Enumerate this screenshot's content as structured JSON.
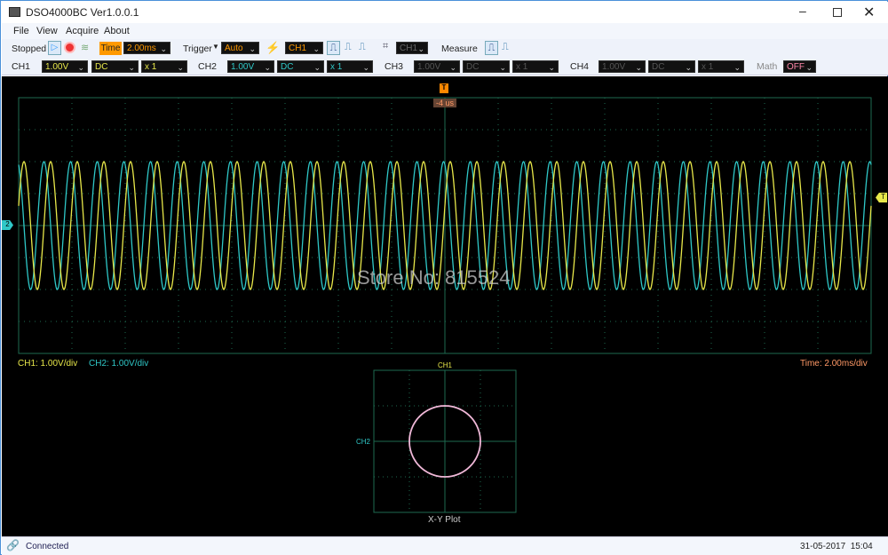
{
  "window": {
    "title": "DSO4000BC Ver1.0.0.1",
    "minimize_icon": "minimize-icon",
    "maximize_icon": "maximize-icon",
    "close_icon": "close-icon"
  },
  "menu": [
    "File",
    "View",
    "Acquire",
    "About"
  ],
  "toolbar": {
    "status": "Stopped",
    "time_label": "Time",
    "timebase": "2.00ms",
    "trigger_label": "Trigger",
    "trigger_mode": "Auto",
    "trigger_source": "CH1",
    "cursor_source": "CH1",
    "measure_label": "Measure"
  },
  "channels": [
    {
      "name": "CH1",
      "volts": "1.00V",
      "coupling": "DC",
      "probe": "x 1",
      "color": "#e8e84a",
      "enabled": true
    },
    {
      "name": "CH2",
      "volts": "1.00V",
      "coupling": "DC",
      "probe": "x 1",
      "color": "#2fc8c8",
      "enabled": true
    },
    {
      "name": "CH3",
      "volts": "1.00V",
      "coupling": "DC",
      "probe": "x 1",
      "enabled": false
    },
    {
      "name": "CH4",
      "volts": "1.00V",
      "coupling": "DC",
      "probe": "x 1",
      "enabled": false
    }
  ],
  "math": {
    "label": "Math",
    "value": "OFF"
  },
  "scope": {
    "trigger_time": "-4 us",
    "trigger_marker": "T",
    "ch2_marker": "2",
    "trigger_level_marker": "T",
    "ch1_scale": "CH1: 1.00V/div",
    "ch2_scale": "CH2: 1.00V/div",
    "time_scale": "Time: 2.00ms/div",
    "watermark": "Store No: 815524",
    "xy_top_label": "CH1",
    "xy_left_label": "CH2",
    "xy_title": "X-Y Plot"
  },
  "chart_data": {
    "type": "line",
    "time_per_div_ms": 2,
    "volts_per_div": 1,
    "x_divisions": 16,
    "y_divisions": 8,
    "xlim_ms": [
      -16,
      16
    ],
    "ylim_v": [
      -4,
      4
    ],
    "grid": true,
    "trigger_level_v": 0.86,
    "series": [
      {
        "name": "CH1",
        "frequency_hz": 1000,
        "amplitude_v": 2,
        "phase_deg": -72,
        "color": "#e8e84a"
      },
      {
        "name": "CH2",
        "frequency_hz": 1000,
        "amplitude_v": 2,
        "phase_deg": 18,
        "color": "#2fc8c8"
      }
    ],
    "xy_plot": {
      "x": "CH2",
      "y": "CH1",
      "divisions": 4,
      "shape": "circle",
      "color": "#f0b8d8"
    }
  },
  "status": {
    "connection": "Connected",
    "datetime": "31-05-2017  15:04"
  }
}
